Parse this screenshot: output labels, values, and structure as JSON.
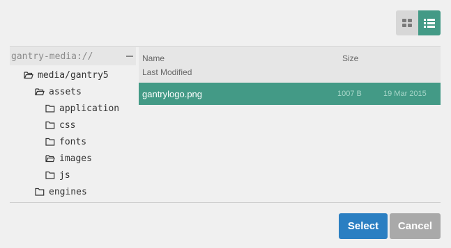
{
  "toolbar": {
    "grid_view_icon": "grid-icon",
    "list_view_icon": "list-icon",
    "active_view": "list"
  },
  "tree": {
    "root_label": "gantry-media://",
    "items": [
      {
        "label": "media/gantry5",
        "icon": "folder-open-icon"
      },
      {
        "label": "assets",
        "icon": "folder-open-icon"
      },
      {
        "label": "application",
        "icon": "folder-icon"
      },
      {
        "label": "css",
        "icon": "folder-icon"
      },
      {
        "label": "fonts",
        "icon": "folder-icon"
      },
      {
        "label": "images",
        "icon": "folder-open-icon"
      },
      {
        "label": "js",
        "icon": "folder-icon"
      },
      {
        "label": "engines",
        "icon": "folder-icon"
      }
    ]
  },
  "filelist": {
    "columns": {
      "name": "Name",
      "size": "Size",
      "modified": "Last Modified"
    },
    "rows": [
      {
        "name": "gantrylogo.png",
        "size": "1007 B",
        "modified": "19 Mar 2015",
        "selected": true
      }
    ]
  },
  "footer": {
    "select_label": "Select",
    "cancel_label": "Cancel"
  },
  "colors": {
    "accent": "#439a86",
    "primary_button": "#2b7fc2",
    "secondary_button": "#a9a9a9"
  }
}
